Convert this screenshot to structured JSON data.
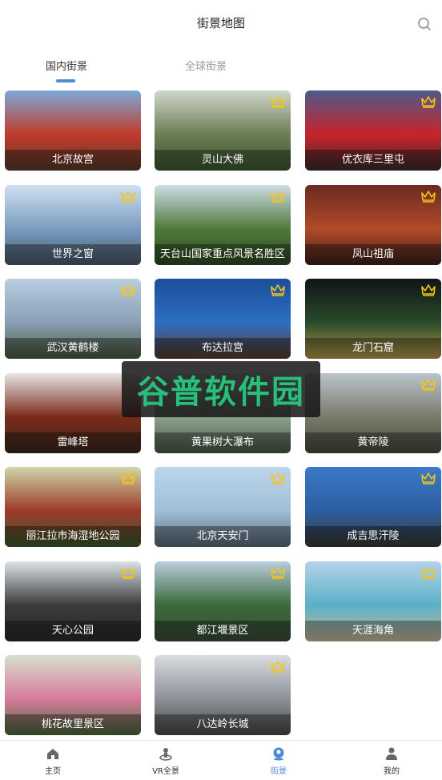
{
  "header": {
    "title": "街景地图"
  },
  "tabs": [
    {
      "label": "国内街景",
      "active": true
    },
    {
      "label": "全球街景",
      "active": false
    }
  ],
  "cards": [
    {
      "name": "北京故宫",
      "crown": false,
      "colors": [
        "#7aa9d8",
        "#c03a2b",
        "#5a3a2a"
      ]
    },
    {
      "name": "灵山大佛",
      "crown": true,
      "colors": [
        "#cfd8c9",
        "#6d7c54",
        "#3a5a30"
      ]
    },
    {
      "name": "优衣库三里屯",
      "crown": true,
      "colors": [
        "#4d5b8a",
        "#c8232a",
        "#3a2b2b"
      ]
    },
    {
      "name": "世界之窗",
      "crown": true,
      "colors": [
        "#cfe0f0",
        "#7a9cc0",
        "#4a5a6a"
      ]
    },
    {
      "name": "天台山国家重点风景名胜区",
      "crown": true,
      "colors": [
        "#cfdde7",
        "#4e7a3a",
        "#2e4a22"
      ]
    },
    {
      "name": "凤山祖庙",
      "crown": true,
      "colors": [
        "#6a2a20",
        "#b34a2a",
        "#3a201a"
      ]
    },
    {
      "name": "武汉黄鹤楼",
      "crown": true,
      "colors": [
        "#b9cde0",
        "#8a9fb5",
        "#4a5a3a"
      ]
    },
    {
      "name": "布达拉宫",
      "crown": true,
      "colors": [
        "#1b4e9a",
        "#2d6fc0",
        "#5a3a2a"
      ]
    },
    {
      "name": "龙门石窟",
      "crown": true,
      "colors": [
        "#121418",
        "#2a4a2a",
        "#b89a4a"
      ]
    },
    {
      "name": "雷峰塔",
      "crown": false,
      "colors": [
        "#e6e6e6",
        "#7a2a1a",
        "#3a2a20"
      ]
    },
    {
      "name": "黄果树大瀑布",
      "crown": false,
      "colors": [
        "#dfe6ea",
        "#8aa18a",
        "#4a5a4a"
      ]
    },
    {
      "name": "黄帝陵",
      "crown": true,
      "colors": [
        "#b9c4cc",
        "#7a7a6a",
        "#4a4a40"
      ]
    },
    {
      "name": "丽江拉市海湿地公园",
      "crown": true,
      "colors": [
        "#cfd7a8",
        "#9c3a2a",
        "#3a5a2a"
      ]
    },
    {
      "name": "北京天安门",
      "crown": true,
      "colors": [
        "#bcd6ea",
        "#9fbfd6",
        "#5a6a7a"
      ]
    },
    {
      "name": "成吉思汗陵",
      "crown": true,
      "colors": [
        "#3a7ac9",
        "#2d5ea0",
        "#3a3a30"
      ]
    },
    {
      "name": "天心公园",
      "crown": true,
      "colors": [
        "#dbe3e8",
        "#3a3a3a",
        "#2a2a2a"
      ]
    },
    {
      "name": "都江堰景区",
      "crown": true,
      "colors": [
        "#b9cde0",
        "#3a6a3a",
        "#3a4a3a"
      ]
    },
    {
      "name": "天涯海角",
      "crown": true,
      "colors": [
        "#b5d2ea",
        "#5ab0c6",
        "#c9b89a"
      ]
    },
    {
      "name": "桃花故里景区",
      "crown": false,
      "colors": [
        "#d6e0cf",
        "#d67a9c",
        "#4a6a3a"
      ]
    },
    {
      "name": "八达岭长城",
      "crown": true,
      "colors": [
        "#d9dde2",
        "#8a9096",
        "#4a4a4a"
      ]
    }
  ],
  "watermark": {
    "text": "谷普软件园"
  },
  "tabbar": [
    {
      "label": "主页",
      "icon": "home-icon",
      "active": false
    },
    {
      "label": "VR全景",
      "icon": "vr-icon",
      "active": false
    },
    {
      "label": "街景",
      "icon": "street-view-icon",
      "active": true
    },
    {
      "label": "我的",
      "icon": "user-icon",
      "active": false
    }
  ],
  "colors": {
    "accent": "#4a8ad9",
    "crown": "#f5c518"
  }
}
